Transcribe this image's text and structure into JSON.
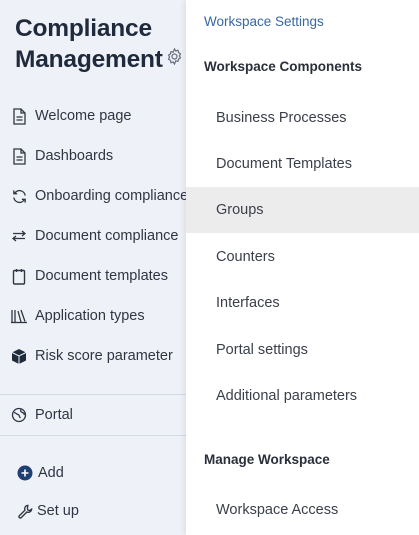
{
  "app": {
    "title_line1": "Compliance",
    "title_line2": "Management",
    "settings_icon": "gear-icon"
  },
  "sidebar": {
    "items": [
      {
        "label": "Welcome page",
        "icon": "document-icon"
      },
      {
        "label": "Dashboards",
        "icon": "document-icon"
      },
      {
        "label": "Onboarding compliance",
        "icon": "sync-icon"
      },
      {
        "label": "Document compliance",
        "icon": "swap-arrows-icon"
      },
      {
        "label": "Document templates",
        "icon": "clipboard-icon"
      },
      {
        "label": "Application types",
        "icon": "library-icon"
      },
      {
        "label": "Risk score parameter",
        "icon": "cube-icon"
      }
    ],
    "portal": {
      "label": "Portal",
      "icon": "globe-icon"
    },
    "add": {
      "label": "Add",
      "icon": "plus-circle-icon"
    },
    "setup": {
      "label": "Set up",
      "icon": "wrench-icon"
    }
  },
  "menu": {
    "header": "Workspace Settings",
    "components_title": "Workspace Components",
    "components": [
      {
        "label": "Business Processes",
        "active": false
      },
      {
        "label": "Document Templates",
        "active": false
      },
      {
        "label": "Groups",
        "active": true
      },
      {
        "label": "Counters",
        "active": false
      },
      {
        "label": "Interfaces",
        "active": false
      },
      {
        "label": "Portal settings",
        "active": false
      },
      {
        "label": "Additional parameters",
        "active": false
      }
    ],
    "manage_title": "Manage Workspace",
    "manage": [
      {
        "label": "Workspace Access",
        "active": false
      }
    ]
  },
  "colors": {
    "sidebar_bg": "#eef2f8",
    "accent": "#3b66a3",
    "hover_bg": "#ececec",
    "add_icon": "#1f3f73"
  }
}
